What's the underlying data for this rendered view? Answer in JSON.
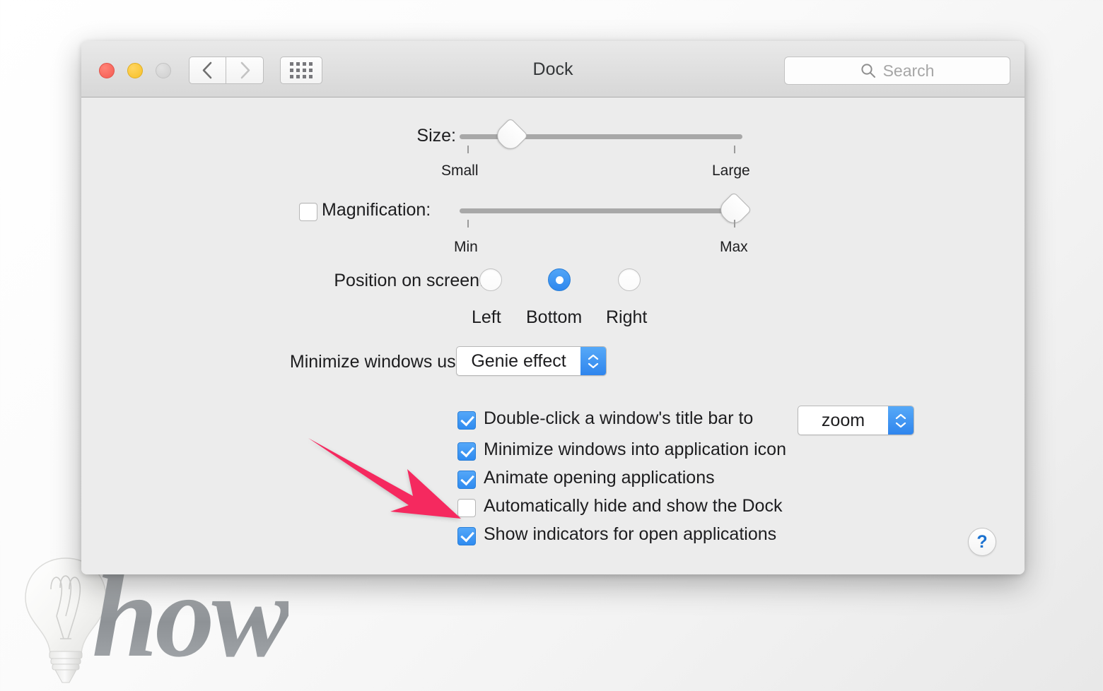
{
  "window": {
    "title": "Dock",
    "traffic_lights": [
      {
        "name": "close",
        "color": "#f45b52"
      },
      {
        "name": "minimize",
        "color": "#f6c028"
      },
      {
        "name": "zoom",
        "color": "#cfcfcf"
      }
    ],
    "nav": {
      "back_icon": "chevron-left-icon",
      "forward_icon": "chevron-right-icon",
      "grid_icon": "grid-apps-icon"
    },
    "search": {
      "icon": "search-icon",
      "placeholder": "Search",
      "value": ""
    }
  },
  "settings": {
    "size": {
      "label": "Size:",
      "min_label": "Small",
      "max_label": "Large",
      "value_percent": 17
    },
    "magnification": {
      "label": "Magnification:",
      "checked": false,
      "min_label": "Min",
      "max_label": "Max",
      "value_percent": 100
    },
    "position": {
      "label": "Position on screen:",
      "selected": "Bottom",
      "options": [
        {
          "label": "Left",
          "selected": false
        },
        {
          "label": "Bottom",
          "selected": true
        },
        {
          "label": "Right",
          "selected": false
        }
      ]
    },
    "minimize_effect": {
      "label": "Minimize windows using:",
      "value": "Genie effect"
    },
    "checkboxes": [
      {
        "label": "Double-click a window's title bar to",
        "checked": true
      },
      {
        "label": "Minimize windows into application icon",
        "checked": true
      },
      {
        "label": "Animate opening applications",
        "checked": true
      },
      {
        "label": "Automatically hide and show the Dock",
        "checked": false
      },
      {
        "label": "Show indicators for open applications",
        "checked": true
      }
    ],
    "double_click_action": {
      "value": "zoom"
    },
    "help": {
      "label": "?"
    }
  },
  "annotation": {
    "arrow_color": "#f5295f",
    "points_to": "Automatically hide and show the Dock"
  },
  "watermark": {
    "text": "how",
    "icon": "lightbulb-icon",
    "color": "#9a9ea1"
  }
}
